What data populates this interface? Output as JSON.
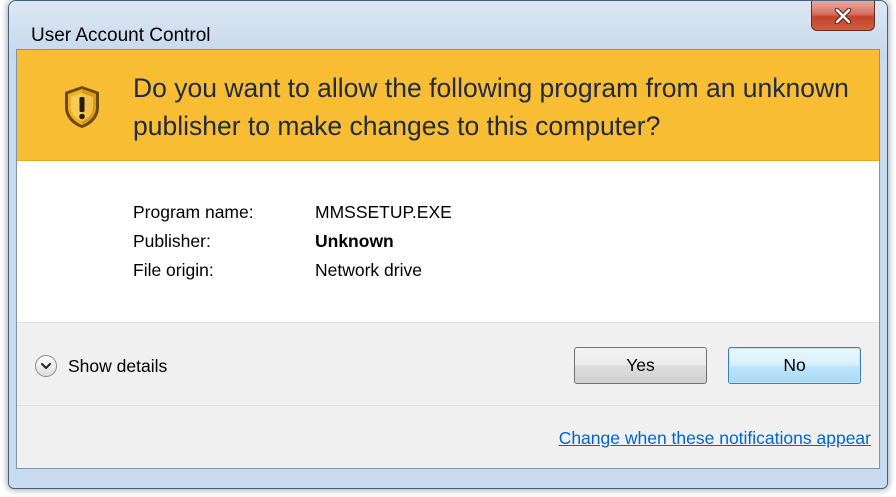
{
  "window": {
    "title": "User Account Control",
    "close_icon": "close-x-icon",
    "close_color": "#c7462e"
  },
  "banner": {
    "icon": "uac-shield-icon",
    "background": "#f9bd33",
    "question": "Do you want to allow the following program from an unknown publisher to make changes to this computer?"
  },
  "info": {
    "rows": [
      {
        "label": "Program name:",
        "value": "MMSSETUP.EXE",
        "bold": false
      },
      {
        "label": "Publisher:",
        "value": "Unknown",
        "bold": true
      },
      {
        "label": "File origin:",
        "value": "Network drive",
        "bold": false
      }
    ]
  },
  "footer": {
    "details_icon": "chevron-down-circle-icon",
    "details_label": "Show details",
    "yes_label": "Yes",
    "no_label": "No"
  },
  "link": {
    "text": "Change when these notifications appear",
    "color": "#0066cc"
  }
}
